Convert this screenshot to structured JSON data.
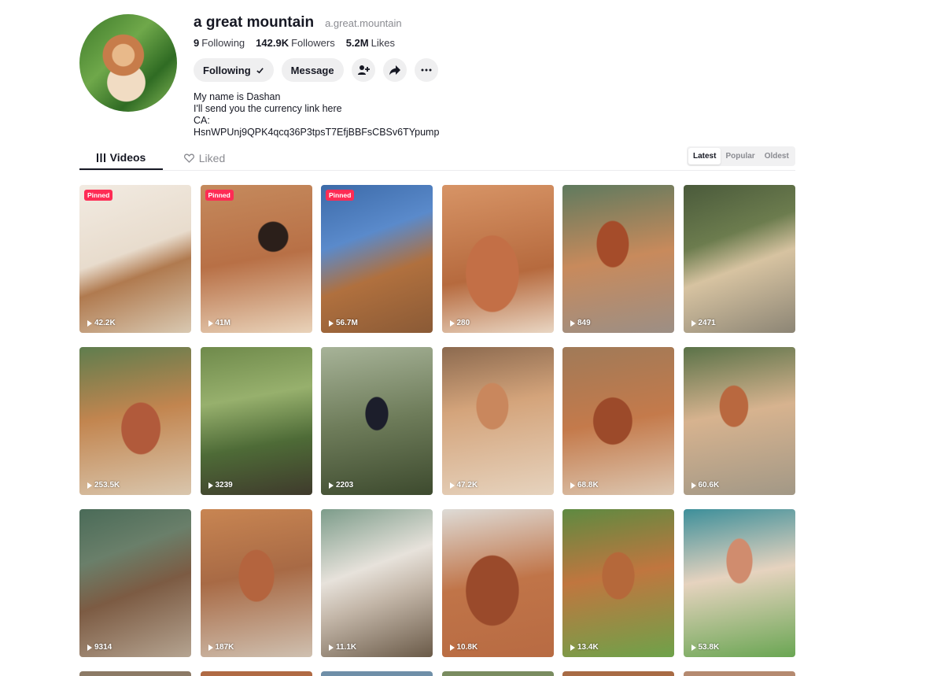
{
  "profile": {
    "display_name": "a great mountain",
    "handle": "a.great.mountain",
    "stats": {
      "following_count": "9",
      "following_label": "Following",
      "followers_count": "142.9K",
      "followers_label": "Followers",
      "likes_count": "5.2M",
      "likes_label": "Likes"
    },
    "following_button": "Following",
    "message_button": "Message",
    "bio": [
      "My name is Dashan",
      "I'll send you the currency link here",
      "CA:",
      "HsnWPUnj9QPK4qcq36P3tpsT7EfjBBFsCBSv6TYpump"
    ]
  },
  "tabs": {
    "videos": "Videos",
    "liked": "Liked"
  },
  "sort": {
    "latest": "Latest",
    "popular": "Popular",
    "oldest": "Oldest",
    "selected": "Latest"
  },
  "pinned_label": "Pinned",
  "videos": [
    {
      "views": "42.2K",
      "pinned": true
    },
    {
      "views": "41M",
      "pinned": true
    },
    {
      "views": "56.7M",
      "pinned": true
    },
    {
      "views": "280",
      "pinned": false
    },
    {
      "views": "849",
      "pinned": false
    },
    {
      "views": "2471",
      "pinned": false
    },
    {
      "views": "253.5K",
      "pinned": false
    },
    {
      "views": "3239",
      "pinned": false
    },
    {
      "views": "2203",
      "pinned": false
    },
    {
      "views": "47.2K",
      "pinned": false
    },
    {
      "views": "68.8K",
      "pinned": false
    },
    {
      "views": "60.6K",
      "pinned": false
    },
    {
      "views": "9314",
      "pinned": false
    },
    {
      "views": "187K",
      "pinned": false
    },
    {
      "views": "11.1K",
      "pinned": false
    },
    {
      "views": "10.8K",
      "pinned": false
    },
    {
      "views": "13.4K",
      "pinned": false
    },
    {
      "views": "53.8K",
      "pinned": false
    }
  ],
  "colors": {
    "accent": "#fe2c55",
    "text": "#161823",
    "muted": "#8a8b91",
    "button_bg": "#efeff0"
  }
}
